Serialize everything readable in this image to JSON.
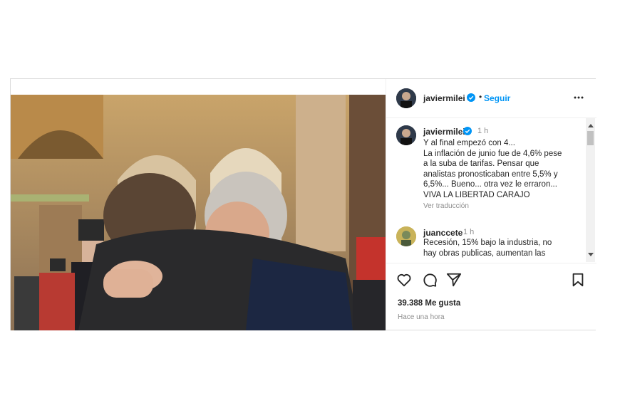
{
  "post": {
    "username": "javiermilei",
    "follow_label": "Seguir",
    "dot": "•",
    "caption": {
      "username": "javiermilei",
      "time": "1 h",
      "lines": [
        "Y al final empezó con 4...",
        "La inflación de junio fue de 4,6% pese",
        "a la suba de tarifas. Pensar que",
        "analistas pronosticaban entre 5,5% y",
        "6,5%... Bueno... otra vez le erraron...",
        "VIVA LA LIBERTAD CARAJO"
      ],
      "translate_label": "Ver traducción"
    },
    "comment": {
      "username": "juanccete",
      "time": "1 h",
      "lines": [
        "Recesión, 15% bajo la industria, no",
        "hay obras publicas, aumentan las"
      ]
    },
    "likes": "39.388 Me gusta",
    "posted": "Hace una hora"
  },
  "icons": {
    "verified": "verified-badge-icon",
    "more": "more-options-icon",
    "like": "heart-icon",
    "comment": "comment-bubble-icon",
    "share": "paper-plane-icon",
    "save": "bookmark-icon"
  },
  "colors": {
    "accent": "#0095f6",
    "verified": "#0095f6",
    "text": "#262626",
    "muted": "#8e8e8e"
  }
}
